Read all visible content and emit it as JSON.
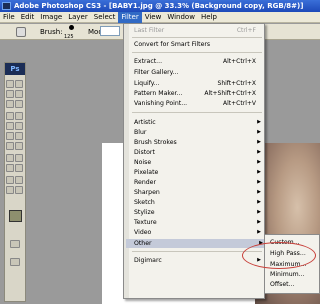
{
  "window": {
    "title": "Adobe Photoshop CS3 - [BABY1.jpg @ 33.3% (Background copy, RGB/8#)]"
  },
  "menubar": {
    "items": [
      "File",
      "Edit",
      "Image",
      "Layer",
      "Select",
      "Filter",
      "View",
      "Window",
      "Help"
    ],
    "active": "Filter"
  },
  "options_bar": {
    "brush_label": "Brush:",
    "brush_size": "125",
    "mode_label": "Mode:"
  },
  "toolbox": {
    "logo": "Ps",
    "foreground_color": "#8e8f6e"
  },
  "filter_menu": {
    "last_filter": {
      "label": "Last Filter",
      "shortcut": "Ctrl+F",
      "enabled": false
    },
    "convert": "Convert for Smart Filters",
    "extract": {
      "label": "Extract...",
      "shortcut": "Alt+Ctrl+X"
    },
    "gallery": "Filter Gallery...",
    "liquify": {
      "label": "Liquify...",
      "shortcut": "Shift+Ctrl+X"
    },
    "pattern": {
      "label": "Pattern Maker...",
      "shortcut": "Alt+Shift+Ctrl+X"
    },
    "vanishing": {
      "label": "Vanishing Point...",
      "shortcut": "Alt+Ctrl+V"
    },
    "groups": [
      "Artistic",
      "Blur",
      "Brush Strokes",
      "Distort",
      "Noise",
      "Pixelate",
      "Render",
      "Sharpen",
      "Sketch",
      "Stylize",
      "Texture",
      "Video"
    ],
    "other": "Other",
    "digimarc": "Digimarc"
  },
  "other_submenu": {
    "items": [
      "Custom...",
      "High Pass...",
      "Maximum...",
      "Minimum...",
      "Offset..."
    ],
    "highlighted": "High Pass..."
  },
  "colors": {
    "menu_highlight": "#c4cad9",
    "title_bar": "#1d49b8",
    "annotation_circle": "#c8403a"
  }
}
